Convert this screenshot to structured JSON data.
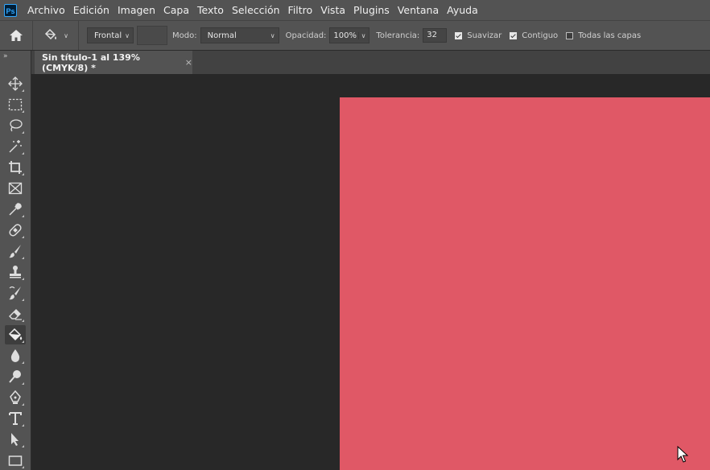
{
  "app": {
    "logo": "Ps"
  },
  "menu": [
    "Archivo",
    "Edición",
    "Imagen",
    "Capa",
    "Texto",
    "Selección",
    "Filtro",
    "Vista",
    "Plugins",
    "Ventana",
    "Ayuda"
  ],
  "options": {
    "fill_source": "Frontal",
    "mode_label": "Modo:",
    "mode_value": "Normal",
    "opacity_label": "Opacidad:",
    "opacity_value": "100%",
    "tolerance_label": "Tolerancia:",
    "tolerance_value": "32",
    "antialias_label": "Suavizar",
    "antialias_checked": true,
    "contiguous_label": "Contiguo",
    "contiguous_checked": true,
    "all_layers_label": "Todas las capas",
    "all_layers_checked": false
  },
  "document_tab": {
    "title": "Sin título-1 al 139% (CMYK/8) *",
    "close_glyph": "×"
  },
  "toolbar": {
    "collapse_glyph": "»",
    "active_tool": "paint-bucket-tool"
  },
  "colors": {
    "document_fill": "#e05866",
    "ui_panel": "#535353",
    "workspace": "#282828"
  }
}
